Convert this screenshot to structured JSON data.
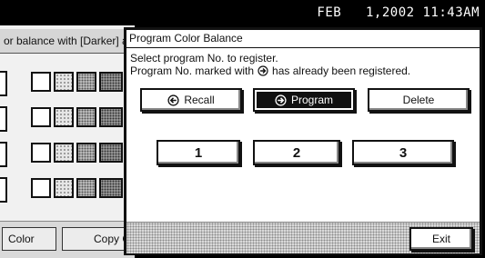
{
  "status_bar": {
    "datetime": "FEB   1,2002 11:43AM"
  },
  "background_screen": {
    "title": "or balance with [Darker] a",
    "bottom_tabs": [
      "Color",
      "Copy C"
    ]
  },
  "dialog": {
    "title": "Program Color Balance",
    "message_line1": "Select program No. to register.",
    "message_line2_before": "Program No. marked with",
    "message_line2_after": "has already been registered.",
    "buttons": {
      "recall": "Recall",
      "program": "Program",
      "delete": "Delete"
    },
    "program_numbers": [
      "1",
      "2",
      "3"
    ],
    "exit_label": "Exit"
  },
  "icons": [
    "recall-arrow-icon",
    "program-arrow-icon",
    "registered-marker-icon"
  ]
}
